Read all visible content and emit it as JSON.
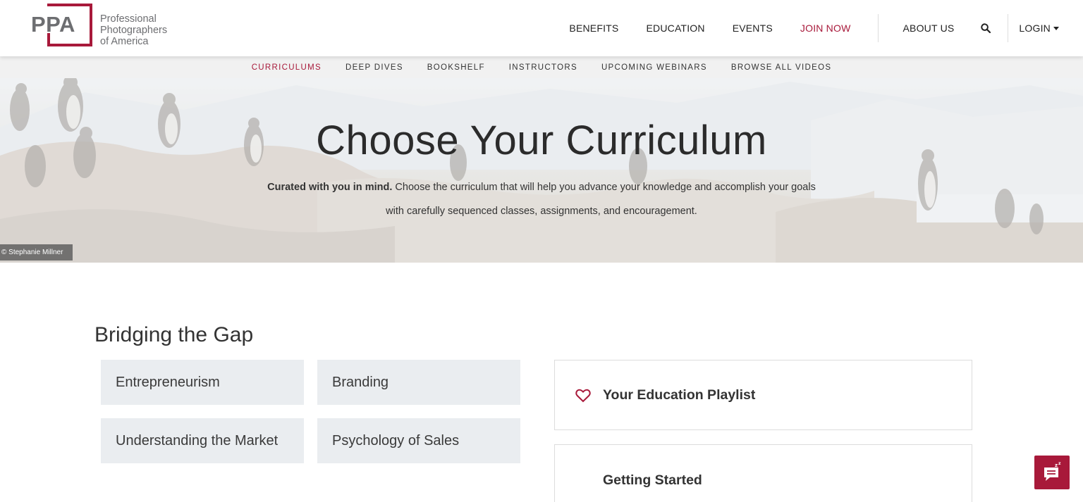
{
  "brand": {
    "logo_mark": "PPA",
    "logo_line1": "Professional",
    "logo_line2": "Photographers",
    "logo_line3": "of America"
  },
  "nav": {
    "benefits": "BENEFITS",
    "education": "EDUCATION",
    "events": "EVENTS",
    "join": "JOIN NOW",
    "about": "ABOUT US",
    "search_icon": "search-icon",
    "login": "LOGIN"
  },
  "subnav": {
    "items": [
      "CURRICULUMS",
      "DEEP DIVES",
      "BOOKSHELF",
      "INSTRUCTORS",
      "UPCOMING WEBINARS",
      "BROWSE ALL VIDEOS"
    ],
    "active": "CURRICULUMS"
  },
  "hero": {
    "title": "Choose Your Curriculum",
    "lead_bold": "Curated with you in mind.",
    "lead_rest": " Choose the curriculum that will help you advance your knowledge and accomplish your goals with carefully sequenced classes, assignments, and encouragement.",
    "credit": "© Stephanie Millner"
  },
  "main": {
    "section_title": "Bridging the Gap",
    "tiles": [
      "Entrepreneurism",
      "Branding",
      "Understanding the Market",
      "Psychology of Sales"
    ]
  },
  "sidebar": {
    "playlist_title": "Your Education Playlist",
    "getting_started_title": "Getting Started"
  },
  "colors": {
    "accent": "#a8193a",
    "tile_bg": "#eaedf0",
    "subnav_bg": "#f1f1f1"
  }
}
